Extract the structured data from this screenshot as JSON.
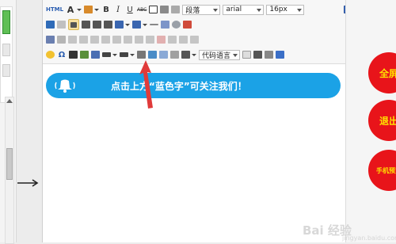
{
  "toolbar": {
    "html_label": "HTML",
    "font_color_label": "A",
    "bold_label": "B",
    "italic_label": "I",
    "underline_label": "U",
    "strike_label": "ABC",
    "paragraph_select": "段落",
    "font_select": "arial",
    "size_select": "16px",
    "code_lang_select": "代码语言",
    "omega_label": "Ω"
  },
  "banner": {
    "text": "点击上方“蓝色字”可关注我们！",
    "color": "#1ba2e6"
  },
  "side_buttons": {
    "fullscreen": "全屏",
    "exit": "退出",
    "mobile": "手机预览"
  },
  "watermark": {
    "main": "Bai 经验",
    "sub": "jingyan.baidu.com"
  },
  "colors": {
    "accent_red": "#e8141a",
    "accent_yellow": "#ffe100",
    "arrow_red": "#e03a3a"
  }
}
